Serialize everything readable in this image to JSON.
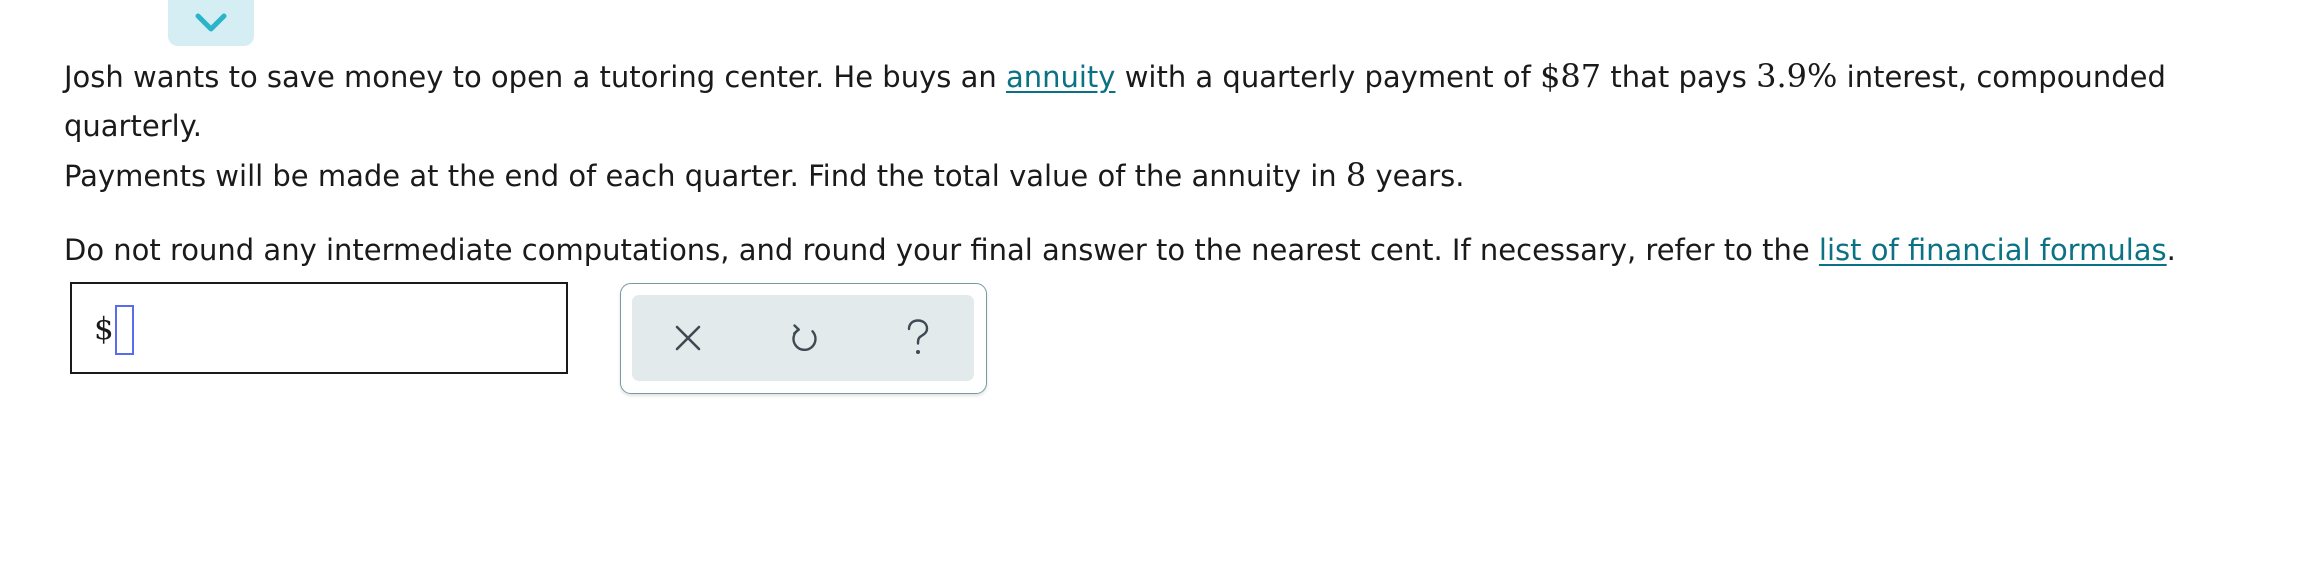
{
  "question": {
    "line1_part1": "Josh wants to save money to open a tutoring center. He buys an",
    "annuity_link": "annuity",
    "line1_part2": "with a quarterly payment of",
    "payment_amount": "$87",
    "line1_part3": "that pays",
    "interest_rate": "3.9%",
    "line1_part4": "interest, compounded quarterly.",
    "line2_part1": "Payments will be made at the end of each quarter. Find the total value of the annuity in",
    "years": "8",
    "line2_part2": "years.",
    "instruction_part1": "Do not round any intermediate computations, and round your final answer to the nearest cent. If necessary, refer to the",
    "formulas_link": "list of financial formulas",
    "instruction_part2": "."
  },
  "answer": {
    "currency_symbol": "$",
    "value": ""
  },
  "icons": {
    "collapse": "chevron-down-icon",
    "clear": "close-icon",
    "undo": "undo-icon",
    "help": "question-mark-icon"
  },
  "colors": {
    "link": "#0b7285",
    "collapse_tab_bg": "#d4eef3",
    "chevron": "#2bb3c9",
    "tool_panel_bg": "#e3eaec",
    "tool_icon": "#3d4a52",
    "cursor_border": "#5b6bf0"
  }
}
